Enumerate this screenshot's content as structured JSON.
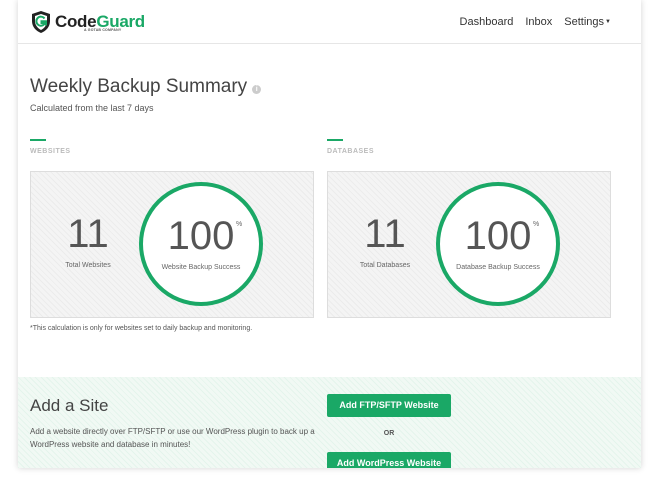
{
  "header": {
    "logo_prefix": "Code",
    "logo_highlight": "Guard",
    "logo_sub": "A GOTAB COMPANY",
    "nav": [
      {
        "label": "Dashboard"
      },
      {
        "label": "Inbox"
      },
      {
        "label": "Settings"
      }
    ]
  },
  "summary": {
    "title": "Weekly Backup Summary",
    "subtitle": "Calculated from the last 7 days",
    "footnote": "*This calculation is only for websites set to daily backup and monitoring."
  },
  "websites": {
    "section_label": "WEBSITES",
    "total_value": "11",
    "total_label": "Total Websites",
    "success_value": "100",
    "success_unit": "%",
    "success_label": "Website Backup Success"
  },
  "databases": {
    "section_label": "DATABASES",
    "total_value": "11",
    "total_label": "Total Databases",
    "success_value": "100",
    "success_unit": "%",
    "success_label": "Database Backup Success"
  },
  "add_site": {
    "title": "Add a Site",
    "description": "Add a website directly over FTP/SFTP or use our WordPress plugin to back up a WordPress website and database in minutes!",
    "ftp_button": "Add FTP/SFTP Website",
    "or_label": "OR",
    "wp_button": "Add WordPress Website"
  },
  "colors": {
    "accent": "#1aa866"
  }
}
